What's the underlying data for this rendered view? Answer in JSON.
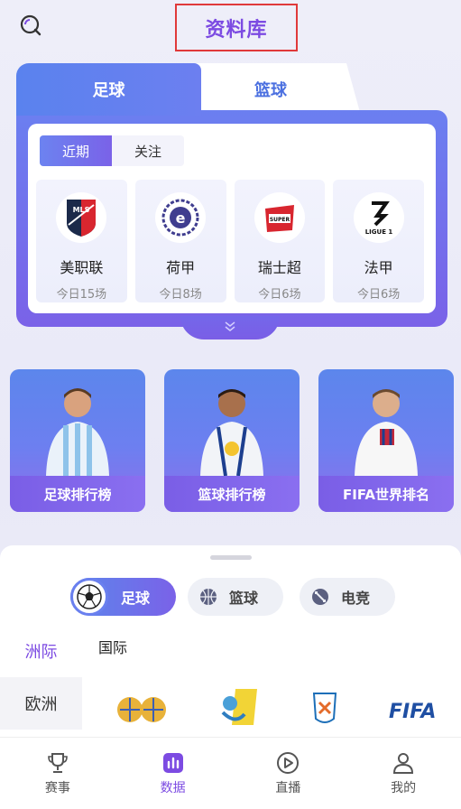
{
  "header": {
    "title": "资料库"
  },
  "main_tabs": [
    {
      "label": "足球"
    },
    {
      "label": "篮球"
    }
  ],
  "sub_tabs": [
    {
      "label": "近期"
    },
    {
      "label": "关注"
    }
  ],
  "leagues": [
    {
      "name": "美职联",
      "count": "今日15场",
      "logo_text": "MLS"
    },
    {
      "name": "荷甲",
      "count": "今日8场",
      "logo_text": "e"
    },
    {
      "name": "瑞士超",
      "count": "今日6场",
      "logo_text": "SUPER"
    },
    {
      "name": "法甲",
      "count": "今日6场",
      "logo_text": "LIGUE 1"
    }
  ],
  "rankings": [
    {
      "label": "足球排行榜"
    },
    {
      "label": "篮球排行榜"
    },
    {
      "label": "FIFA世界排名"
    }
  ],
  "sports": [
    {
      "label": "足球"
    },
    {
      "label": "篮球"
    },
    {
      "label": "电竞"
    }
  ],
  "sidebar": [
    {
      "label": "洲际"
    },
    {
      "label": "欧洲"
    }
  ],
  "region": {
    "label": "国际"
  },
  "orgs": [
    {
      "name": "olympic-logo"
    },
    {
      "name": "my-game-logo"
    },
    {
      "name": "cee-cup-logo"
    },
    {
      "name": "FIFA"
    }
  ],
  "nav": [
    {
      "label": "赛事"
    },
    {
      "label": "数据"
    },
    {
      "label": "直播"
    },
    {
      "label": "我的"
    }
  ],
  "colors": {
    "accent": "#7c4be2",
    "blue": "#5c86ec",
    "highlight_box": "#e0393a"
  }
}
